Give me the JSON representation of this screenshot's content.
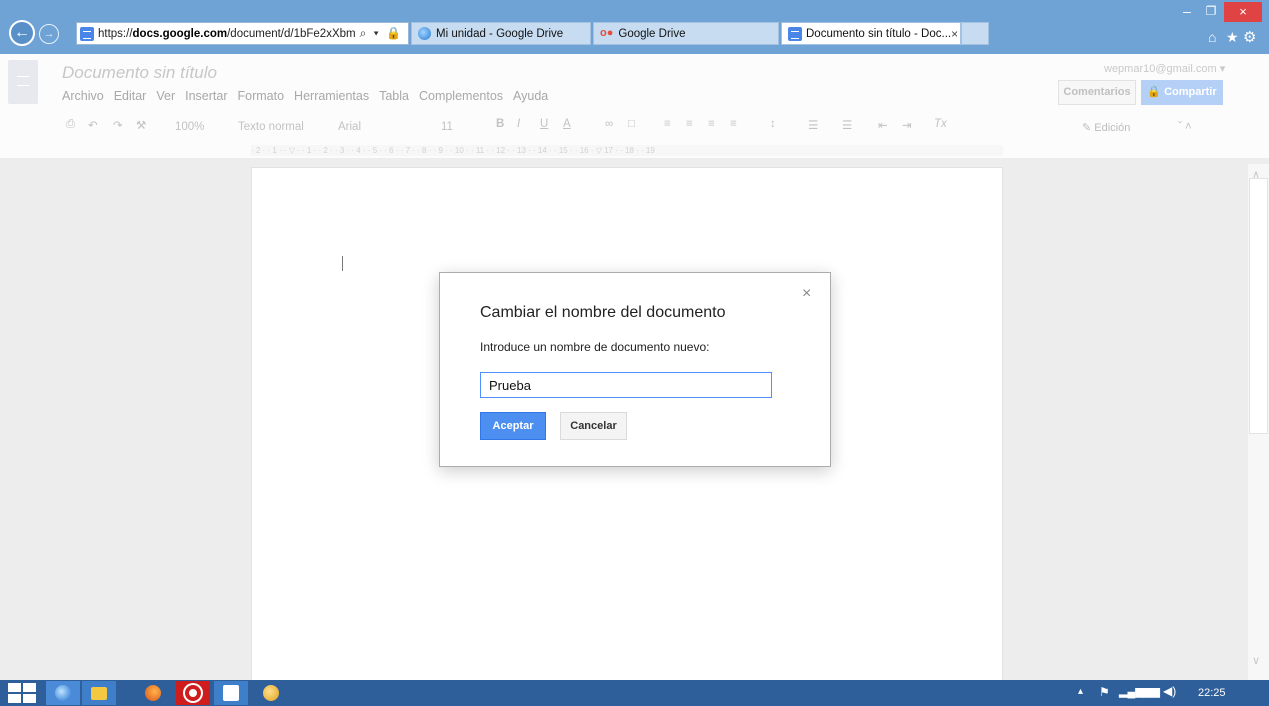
{
  "browser": {
    "url_prefix": "https://",
    "url_domain": "docs.google.com",
    "url_path": "/document/d/1bFe2xXbm",
    "address_tools": "⌕ ▾ 🔒 ↻",
    "tabs": [
      {
        "label": "Mi unidad - Google Drive"
      },
      {
        "label": "Google Drive",
        "favicon_text": "o●"
      },
      {
        "label": "Documento sin título - Doc...",
        "close": "×"
      }
    ],
    "window_controls": {
      "minimize": "–",
      "maximize": "❐",
      "close": "×"
    },
    "right_icons": {
      "home": "⌂",
      "favorites": "★",
      "settings": "⚙"
    }
  },
  "docs": {
    "title": "Documento sin título",
    "user_email": "wepmar10@gmail.com ▾",
    "comments_label": "Comentarios",
    "share_label": "🔒 Compartir",
    "menu": [
      "Archivo",
      "Editar",
      "Ver",
      "Insertar",
      "Formato",
      "Herramientas",
      "Tabla",
      "Complementos",
      "Ayuda"
    ],
    "toolbar": {
      "print": "⎙",
      "undo": "↶",
      "redo": "↷",
      "paint_format": "⚒",
      "zoom": "100%",
      "style": "Texto normal",
      "font": "Arial",
      "size": "11",
      "bold": "B",
      "italic": "I",
      "underline": "U",
      "text_color": "A",
      "link": "∞",
      "comment": "□",
      "align_left": "≡",
      "align_center": "≡",
      "align_right": "≡",
      "justify": "≡",
      "line_spacing": "↕",
      "numbered_list": "☰",
      "bulleted_list": "☰",
      "decrease_indent": "⇤",
      "increase_indent": "⇥",
      "clear_format": "Tx",
      "edit_mode": "✎  Edición",
      "collapse": "ˇ  ˄"
    },
    "ruler_text": "· 2 · · 1 · · ▽ · · 1 · · 2 · · 3 · · 4 · · 5 · · 6 · · 7 · · 8 · · 9 · · 10 · · 11 · · 12 · · 13 · · 14 · · 15 · · 16 · ▽ 17 · · 18 · · 19",
    "scroll_up": "∧",
    "scroll_down": "∨"
  },
  "dialog": {
    "close": "×",
    "title": "Cambiar el nombre del documento",
    "label": "Introduce un nombre de documento nuevo:",
    "input_value": "Prueba",
    "accept_label": "Aceptar",
    "cancel_label": "Cancelar"
  },
  "taskbar": {
    "tray": {
      "arrow": "▴",
      "flag": "⚑",
      "signal": "▂▄▆",
      "network": "▆▆",
      "volume": "◀)"
    },
    "clock": "22:25"
  },
  "colors": {
    "accent": "#4d8ff0",
    "ie_bar": "#6fa3d6",
    "taskbar": "#2f5f9a",
    "close_red": "#e04343"
  }
}
